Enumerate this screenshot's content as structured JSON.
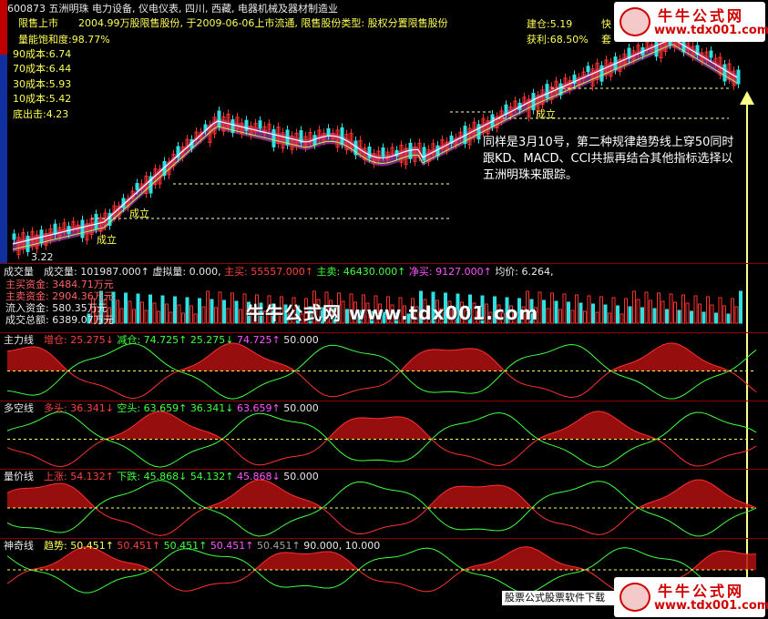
{
  "header": {
    "code_name": "600873 五洲明珠  电力设备, 仪电仪表, 四川, 西藏, 电器机械及器材制造业",
    "restricted_label": "限售上市",
    "restricted_info": "2004.99万股限售股份, 于2009-06-06上市流通, 限售股份类型: 股权分置限售股份",
    "saturation": "量能饱和度:98.77%",
    "cost_90": "90成本:6.74",
    "cost_70": "70成本:6.44",
    "cost_30": "30成本:5.93",
    "cost_10": "10成本:5.42",
    "bottom_out": "底出击:4.23",
    "build_pos": "建仓:5.19",
    "profit": "获利:68.50%",
    "right_cut1": "快",
    "right_cut2": "套",
    "low_mark": "3.22",
    "formed1": "成立",
    "formed2": "成立",
    "formed3": "成立"
  },
  "annotation": "同样是3月10号，第二种规律趋势线上穿50同时跟KD、MACD、CCI共振再结合其他指标选择以五洲明珠来跟踪。",
  "watermark": {
    "center": "牛牛公式网 www.tdx001.com",
    "logo_cn": "牛牛公式网",
    "logo_url": "www.tdx001.com"
  },
  "volume_panel": {
    "title": "成交量",
    "values": [
      {
        "text": "成交量: 101987.000↑",
        "color": "#e8e8e8"
      },
      {
        "text": "虚拟量: 0.000,",
        "color": "#e8e8e8"
      },
      {
        "text": "主买: 55557.000↑",
        "color": "#ff4040"
      },
      {
        "text": "主卖: 46430.000↑",
        "color": "#40ff40"
      },
      {
        "text": "净买: 9127.000↑",
        "color": "#ff55ff"
      },
      {
        "text": "均价: 6.264,",
        "color": "#e8e8e8"
      }
    ],
    "left_labels": [
      "主买资金: 3484.71万元",
      "主卖资金: 2904.36万元",
      "流入资金: 580.35万元",
      "成交总额: 6389.07万元"
    ]
  },
  "panels": [
    {
      "name": "主力线",
      "values": [
        {
          "text": "增仓: 25.275↓",
          "color": "#ff4040"
        },
        {
          "text": "减仓: 74.725↑",
          "color": "#40ff40"
        },
        {
          "text": "25.275↓",
          "color": "#40ff40"
        },
        {
          "text": "74.725↑",
          "color": "#ff55ff"
        },
        {
          "text": "50.000",
          "color": "#e8e8e8"
        }
      ]
    },
    {
      "name": "多空线",
      "values": [
        {
          "text": "多头: 36.341↓",
          "color": "#ff4040"
        },
        {
          "text": "空头: 63.659↑",
          "color": "#40ff40"
        },
        {
          "text": "36.341↓",
          "color": "#40ff40"
        },
        {
          "text": "63.659↑",
          "color": "#ff55ff"
        },
        {
          "text": "50.000",
          "color": "#e8e8e8"
        }
      ]
    },
    {
      "name": "量价线",
      "values": [
        {
          "text": "上涨: 54.132↑",
          "color": "#ff4040"
        },
        {
          "text": "下跌: 45.868↓",
          "color": "#40ff40"
        },
        {
          "text": "54.132↑",
          "color": "#40ff40"
        },
        {
          "text": "45.868↓",
          "color": "#ff55ff"
        },
        {
          "text": "50.000",
          "color": "#e8e8e8"
        }
      ]
    },
    {
      "name": "神奇线",
      "values": [
        {
          "text": "趋势: 50.451↑",
          "color": "#ffff55"
        },
        {
          "text": "50.451↑",
          "color": "#ff4040"
        },
        {
          "text": "50.451↑",
          "color": "#40ff40"
        },
        {
          "text": "50.451↑",
          "color": "#ff55ff"
        },
        {
          "text": "50.451↑",
          "color": "#a0a0a0"
        },
        {
          "text": "90.000, 10.000",
          "color": "#e8e8e8"
        }
      ]
    }
  ],
  "status_bar": "股票公式股票软件下载",
  "colors": {
    "up": "#ff3030",
    "down": "#30e0e0",
    "ma": "#ffffff",
    "trend": "#aaff55",
    "band": "#8a2b8a",
    "grid": "#8b0000",
    "arrow": "#ffff88"
  }
}
